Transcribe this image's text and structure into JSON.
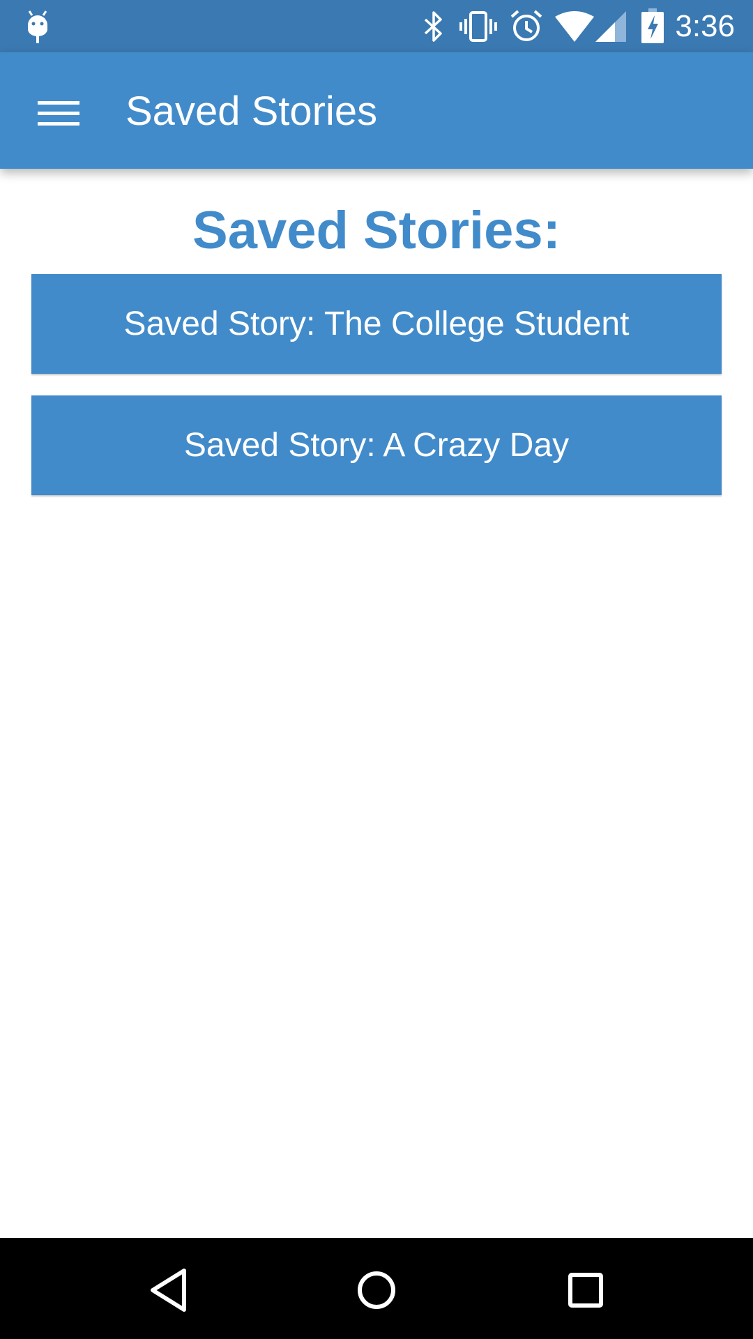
{
  "status_bar": {
    "time": "3:36",
    "icons": [
      "android-debug-icon",
      "bluetooth-icon",
      "vibrate-icon",
      "alarm-icon",
      "wifi-icon",
      "cell-signal-icon",
      "battery-charging-icon"
    ]
  },
  "app_bar": {
    "title": "Saved Stories",
    "menu_icon": "hamburger-menu-icon"
  },
  "main": {
    "heading": "Saved Stories:",
    "stories": [
      {
        "label": "Saved Story: The College Student"
      },
      {
        "label": "Saved Story: A Crazy Day"
      }
    ]
  },
  "nav_bar": {
    "buttons": [
      "back-icon",
      "home-icon",
      "recents-icon"
    ]
  },
  "colors": {
    "status_bar": "#3b79b2",
    "primary": "#428bca",
    "background": "#ffffff",
    "nav_bar": "#000000"
  }
}
